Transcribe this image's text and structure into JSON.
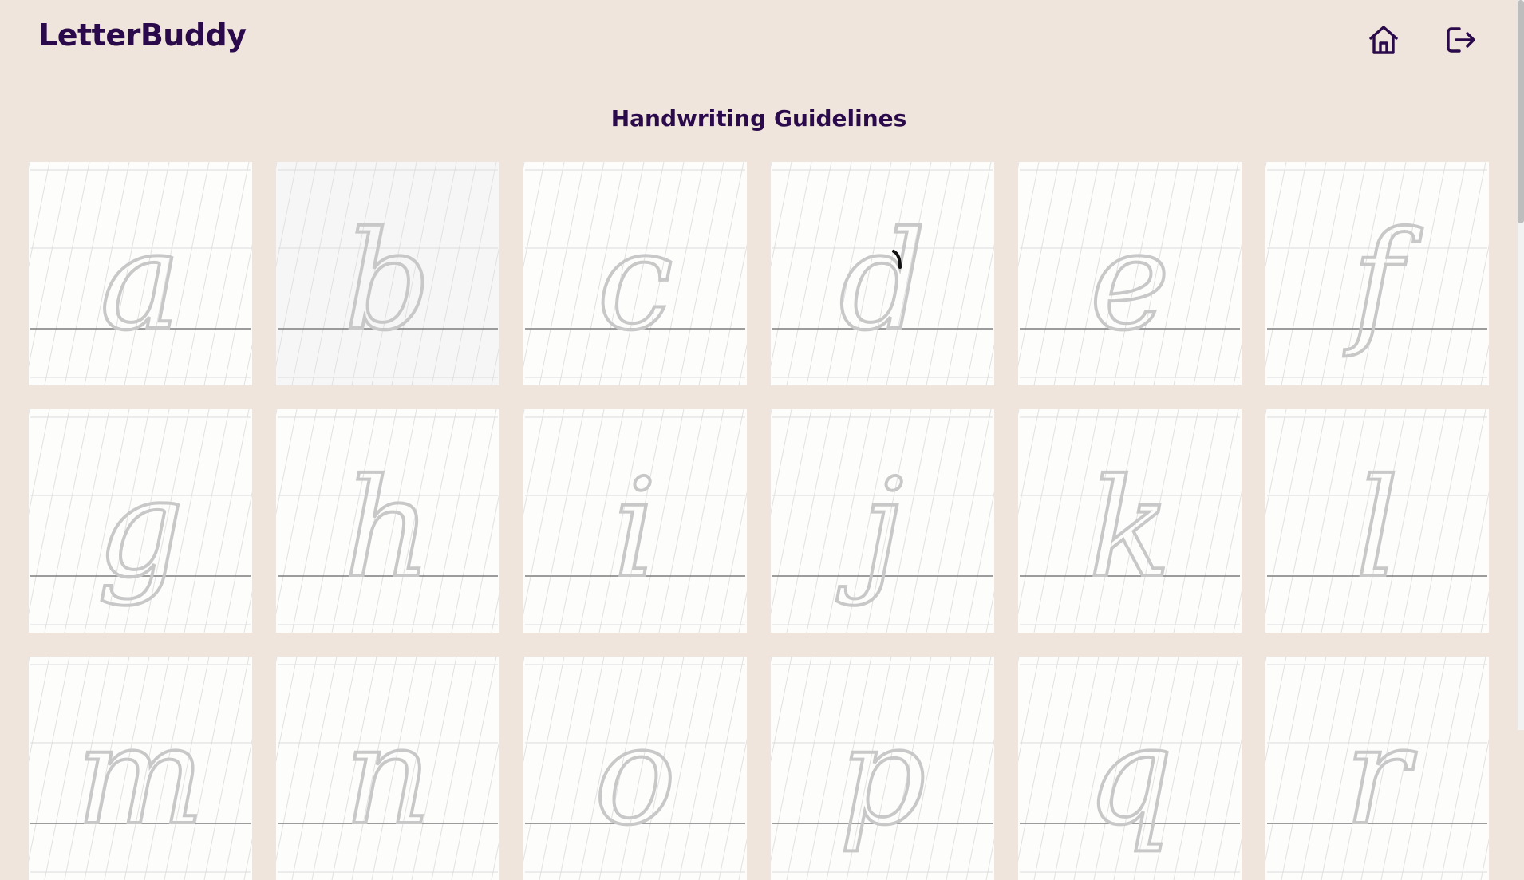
{
  "app": {
    "brand": "LetterBuddy"
  },
  "header": {
    "home_icon": "home-icon",
    "logout_icon": "logout-icon"
  },
  "page": {
    "title": "Handwriting Guidelines"
  },
  "letters": [
    "a",
    "b",
    "c",
    "d",
    "e",
    "f",
    "g",
    "h",
    "i",
    "j",
    "k",
    "l",
    "m",
    "n",
    "o",
    "p",
    "q",
    "r"
  ],
  "colors": {
    "background": "#efe5dc",
    "brand": "#2a0a4a",
    "card": "#fdfdfb",
    "guide_letter": "#c8c8c8",
    "baseline": "#808080",
    "active_stroke": "#111111"
  }
}
